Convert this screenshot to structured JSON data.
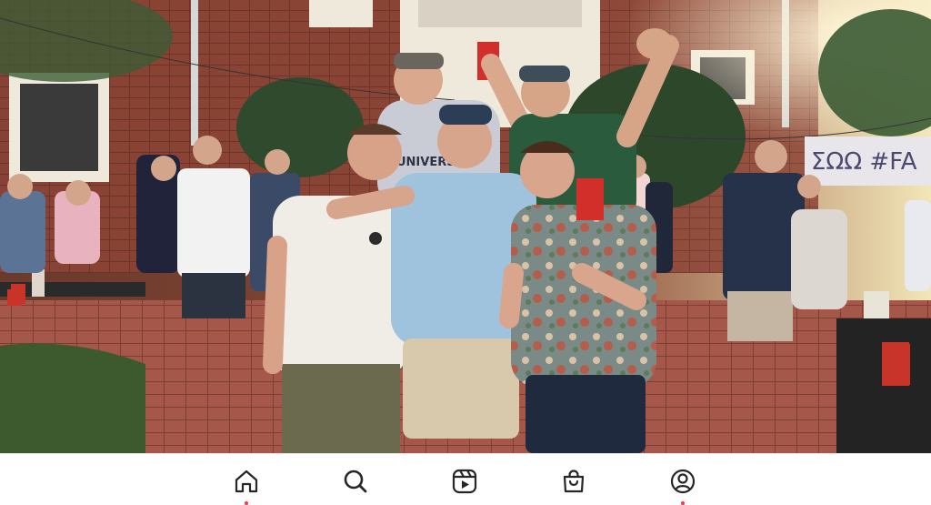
{
  "photo": {
    "subject": "group-photo",
    "banner_text": "ΣΩΩ  #FA",
    "shirt_text": "UNIVERS"
  },
  "navbar": {
    "items": [
      {
        "id": "home",
        "icon": "home-icon",
        "active": true,
        "notification_dot": true
      },
      {
        "id": "search",
        "icon": "search-icon",
        "active": false,
        "notification_dot": false
      },
      {
        "id": "reels",
        "icon": "reels-icon",
        "active": false,
        "notification_dot": false
      },
      {
        "id": "shop",
        "icon": "shopping-bag-icon",
        "active": false,
        "notification_dot": false
      },
      {
        "id": "profile",
        "icon": "profile-icon",
        "active": false,
        "notification_dot": true
      }
    ],
    "colors": {
      "icon": "#262626",
      "notification": "#ff3040"
    }
  }
}
